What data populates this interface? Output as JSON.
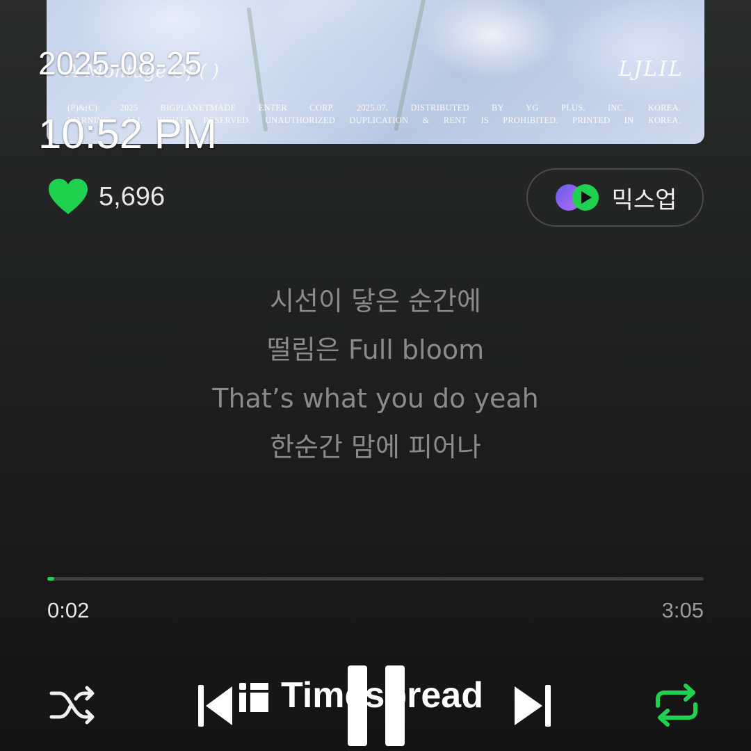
{
  "album_art": {
    "album_title": "A Montage Of (   )",
    "artist_logo": "LJLIL",
    "credit_line_1": "(P)&(C) 2025 BIGPLANETMADE ENTER CORP. 2025.07. DISTRIBUTED BY YG PLUS, INC. KOREA.",
    "credit_line_2": "WARNING: ALL RIGHTS RESERVED. UNAUTHORIZED DUPLICATION & RENT IS PROHIBITED. PRINTED IN KOREA."
  },
  "overlay": {
    "date": "2025-08-25",
    "time": "10:52 PM"
  },
  "like": {
    "count": "5,696",
    "icon": "heart-icon",
    "color": "#1fd14e"
  },
  "mixup": {
    "label": "믹스업",
    "icon": "mixup-icon"
  },
  "lyrics": [
    "시선이 닿은 순간에",
    "떨림은 Full bloom",
    "That’s what you do yeah",
    "한순간 맘에 피어나"
  ],
  "playback": {
    "current_time": "0:02",
    "total_time": "3:05",
    "progress_fraction": 0.011
  },
  "controls": {
    "shuffle_icon": "shuffle-icon",
    "prev_icon": "skip-previous-icon",
    "pause_icon": "pause-icon",
    "next_icon": "skip-next-icon",
    "repeat_icon": "repeat-icon",
    "accent_color": "#1fd14e"
  },
  "watermark": {
    "text": "Timespread"
  }
}
